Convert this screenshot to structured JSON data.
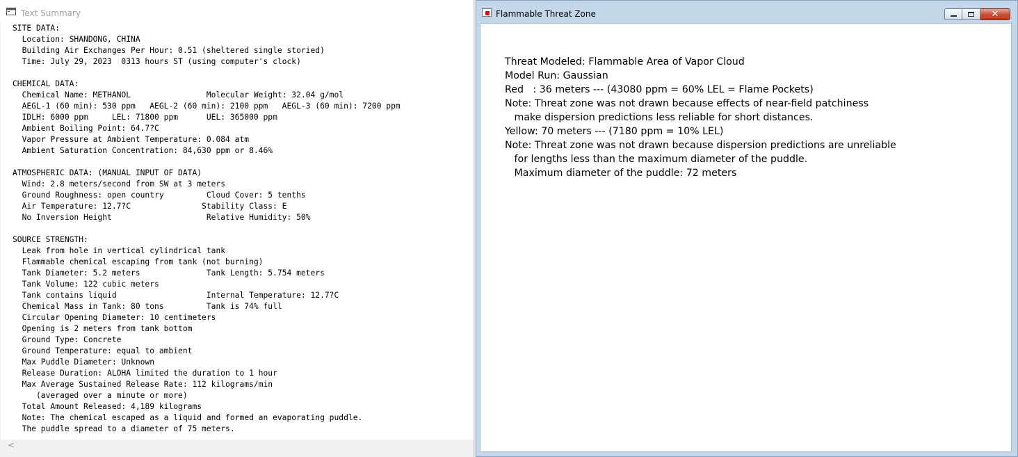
{
  "summary_window": {
    "title": "Text Summary",
    "scroll_left_arrow": "<",
    "lines": [
      "SITE DATA:",
      "  Location: SHANDONG, CHINA",
      "  Building Air Exchanges Per Hour: 0.51 (sheltered single storied)",
      "  Time: July 29, 2023  0313 hours ST (using computer's clock)",
      "",
      "CHEMICAL DATA:",
      "  Chemical Name: METHANOL                Molecular Weight: 32.04 g/mol",
      "  AEGL-1 (60 min): 530 ppm   AEGL-2 (60 min): 2100 ppm   AEGL-3 (60 min): 7200 ppm",
      "  IDLH: 6000 ppm     LEL: 71800 ppm      UEL: 365000 ppm",
      "  Ambient Boiling Point: 64.7?C",
      "  Vapor Pressure at Ambient Temperature: 0.084 atm",
      "  Ambient Saturation Concentration: 84,630 ppm or 8.46%",
      "",
      "ATMOSPHERIC DATA: (MANUAL INPUT OF DATA)",
      "  Wind: 2.8 meters/second from SW at 3 meters",
      "  Ground Roughness: open country         Cloud Cover: 5 tenths",
      "  Air Temperature: 12.7?C               Stability Class: E",
      "  No Inversion Height                    Relative Humidity: 50%",
      "",
      "SOURCE STRENGTH:",
      "  Leak from hole in vertical cylindrical tank",
      "  Flammable chemical escaping from tank (not burning)",
      "  Tank Diameter: 5.2 meters              Tank Length: 5.754 meters",
      "  Tank Volume: 122 cubic meters",
      "  Tank contains liquid                   Internal Temperature: 12.7?C",
      "  Chemical Mass in Tank: 80 tons         Tank is 74% full",
      "  Circular Opening Diameter: 10 centimeters",
      "  Opening is 2 meters from tank bottom",
      "  Ground Type: Concrete",
      "  Ground Temperature: equal to ambient",
      "  Max Puddle Diameter: Unknown",
      "  Release Duration: ALOHA limited the duration to 1 hour",
      "  Max Average Sustained Release Rate: 112 kilograms/min",
      "     (averaged over a minute or more)",
      "  Total Amount Released: 4,189 kilograms",
      "  Note: The chemical escaped as a liquid and formed an evaporating puddle.",
      "  The puddle spread to a diameter of 75 meters."
    ]
  },
  "threat_window": {
    "title": "Flammable Threat Zone",
    "close_glyph": "✕",
    "lines": [
      "Threat Modeled: Flammable Area of Vapor Cloud",
      "Model Run: Gaussian",
      "Red   : 36 meters --- (43080 ppm = 60% LEL = Flame Pockets)",
      "Note: Threat zone was not drawn because effects of near-field patchiness",
      "   make dispersion predictions less reliable for short distances.",
      "Yellow: 70 meters --- (7180 ppm = 10% LEL)",
      "Note: Threat zone was not drawn because dispersion predictions are unreliable",
      "   for lengths less than the maximum diameter of the puddle.",
      "   Maximum diameter of the puddle: 72 meters"
    ]
  }
}
